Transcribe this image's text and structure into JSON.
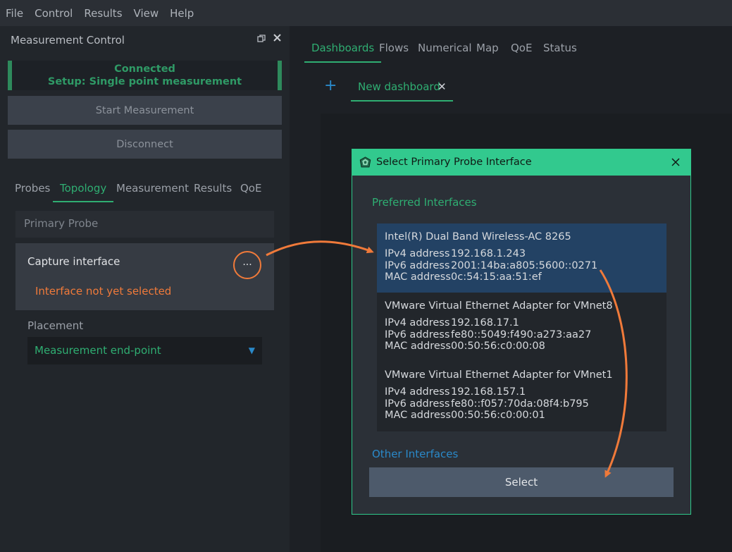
{
  "menu": [
    "File",
    "Control",
    "Results",
    "View",
    "Help"
  ],
  "measurement_control": {
    "title": "Measurement Control",
    "status_line1": "Connected",
    "status_line2": "Setup: Single point measurement",
    "start_button": "Start Measurement",
    "disconnect_button": "Disconnect",
    "tabs": [
      "Probes",
      "Topology",
      "Measurement",
      "Results",
      "QoE"
    ],
    "active_tab": "Topology",
    "primary_probe": "Primary Probe",
    "capture_label": "Capture interface",
    "dots": "···",
    "capture_warning": "Interface not yet selected",
    "placement_label": "Placement",
    "placement_value": "Measurement end-point"
  },
  "main_tabs": [
    "Dashboards",
    "Flows",
    "Numerical",
    "Map",
    "QoE",
    "Status"
  ],
  "active_main_tab": "Dashboards",
  "dashboard": {
    "add": "+",
    "tab_label": "New dashboard",
    "close": "✕"
  },
  "dialog": {
    "title": "Select Primary Probe Interface",
    "close": "✕",
    "preferred_label": "Preferred Interfaces",
    "other_label": "Other Interfaces",
    "select_button": "Select",
    "interfaces": [
      {
        "name": "Intel(R) Dual Band Wireless-AC 8265",
        "ipv4_label": "IPv4 address",
        "ipv4": "192.168.1.243",
        "ipv6_label": "IPv6 address",
        "ipv6": "2001:14ba:a805:5600::0271",
        "mac_label": "MAC address",
        "mac": "0c:54:15:aa:51:ef",
        "selected": true
      },
      {
        "name": "VMware Virtual Ethernet Adapter for VMnet8",
        "ipv4_label": "IPv4 address",
        "ipv4": "192.168.17.1",
        "ipv6_label": "IPv6 address",
        "ipv6": "fe80::5049:f490:a273:aa27",
        "mac_label": "MAC address",
        "mac": "00:50:56:c0:00:08",
        "selected": false
      },
      {
        "name": "VMware Virtual Ethernet Adapter for VMnet1",
        "ipv4_label": "IPv4 address",
        "ipv4": "192.168.157.1",
        "ipv6_label": "IPv6 address",
        "ipv6": "fe80::f057:70da:08f4:b795",
        "mac_label": "MAC address",
        "mac": "00:50:56:c0:00:01",
        "selected": false
      }
    ]
  },
  "colors": {
    "accent_green": "#2fae72",
    "warning_orange": "#f07a3a",
    "link_blue": "#2a89c9",
    "selected_row": "#234264"
  }
}
